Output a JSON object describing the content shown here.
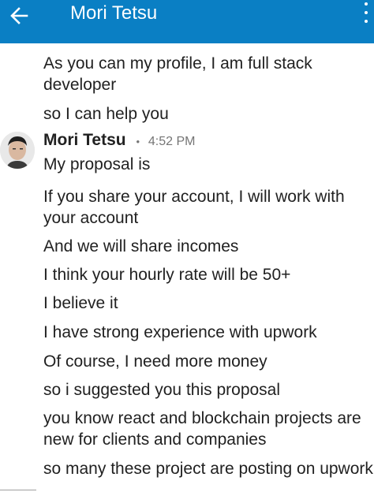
{
  "app_bar": {
    "title": "Mori Tetsu",
    "back_icon": "arrow-left-icon",
    "more_icon": "more-vertical-icon",
    "color": "#0a7fc4"
  },
  "messages_before": [
    "As you can my profile, I am full stack developer",
    "so I can help you"
  ],
  "group": {
    "sender": "Mori Tetsu",
    "separator": "•",
    "time": "4:52 PM",
    "messages": [
      "My proposal is",
      "If you share your account, I will work with your account",
      "And we will share incomes",
      "I think your hourly rate will be 50+",
      "I believe it",
      "I have strong experience with upwork",
      "Of course, I need more money",
      "so i suggested you this proposal",
      "you know react and blockchain projects are new for clients and companies",
      "so many these project are posting on upwork"
    ]
  }
}
